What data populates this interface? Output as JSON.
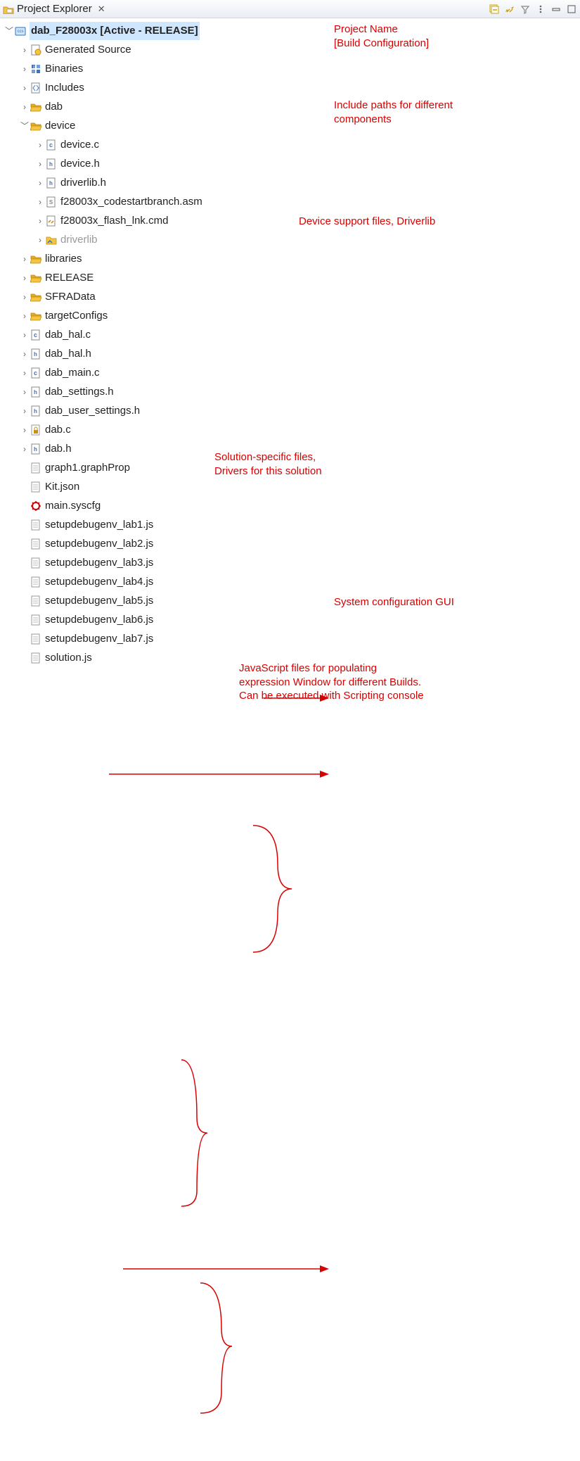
{
  "header": {
    "title": "Project Explorer"
  },
  "project": {
    "name": "dab_F28003x  [Active - RELEASE]"
  },
  "nodes": {
    "generated_source": "Generated Source",
    "binaries": "Binaries",
    "includes": "Includes",
    "dab_folder": "dab",
    "device": "device",
    "device_c": "device.c",
    "device_h": "device.h",
    "driverlib_h": "driverlib.h",
    "codestart": "f28003x_codestartbranch.asm",
    "flash_lnk": "f28003x_flash_lnk.cmd",
    "driverlib": "driverlib",
    "libraries": "libraries",
    "release": "RELEASE",
    "sfradata": "SFRAData",
    "targetconfigs": "targetConfigs",
    "dab_hal_c": "dab_hal.c",
    "dab_hal_h": "dab_hal.h",
    "dab_main_c": "dab_main.c",
    "dab_settings_h": "dab_settings.h",
    "dab_user_settings_h": "dab_user_settings.h",
    "dab_c": "dab.c",
    "dab_h": "dab.h",
    "graph1": "graph1.graphProp",
    "kit_json": "Kit.json",
    "main_syscfg": "main.syscfg",
    "lab1": "setupdebugenv_lab1.js",
    "lab2": "setupdebugenv_lab2.js",
    "lab3": "setupdebugenv_lab3.js",
    "lab4": "setupdebugenv_lab4.js",
    "lab5": "setupdebugenv_lab5.js",
    "lab6": "setupdebugenv_lab6.js",
    "lab7": "setupdebugenv_lab7.js",
    "solution_js": "solution.js"
  },
  "annotations": {
    "project_name": "Project Name\n[Build Configuration]",
    "include_paths": "Include paths for different\ncomponents",
    "device_support": "Device support files, Driverlib",
    "solution_files": "Solution-specific files,\nDrivers for this solution",
    "syscfg": "System configuration GUI",
    "js_files": "JavaScript files for populating\nexpression Window for different Builds.\nCan be executed with Scripting console"
  }
}
